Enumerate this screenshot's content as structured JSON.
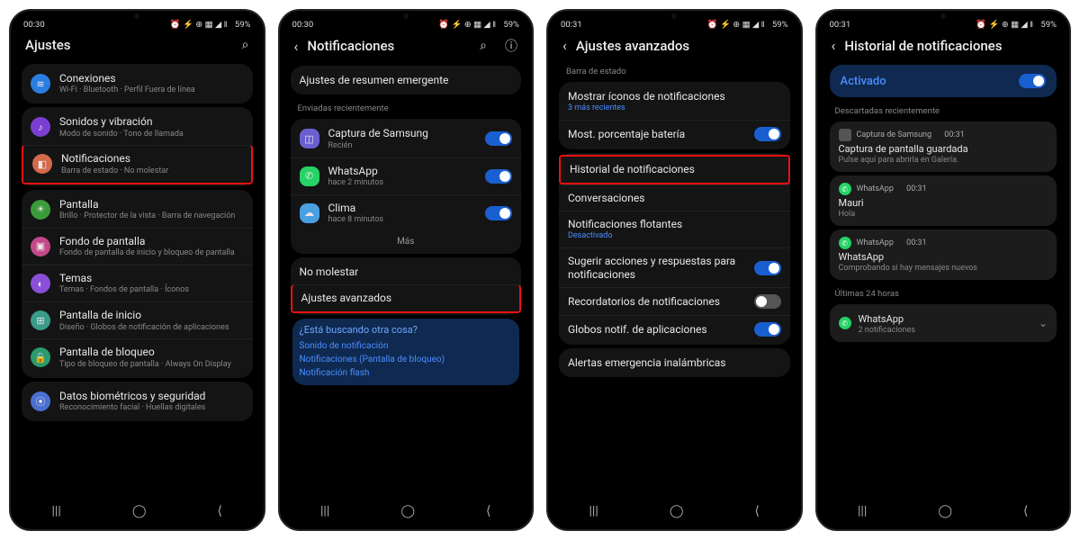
{
  "status": {
    "time1": "00:30",
    "time2": "00:30",
    "time3": "00:31",
    "time4": "00:31",
    "battery": "59%",
    "icons": "⏰ ⚡ ⊕ ▦ ◢ ‖"
  },
  "screen1": {
    "title": "Ajustes",
    "items": [
      {
        "title": "Conexiones",
        "sub": "Wi-Fi · Bluetooth · Perfil Fuera de línea",
        "color": "#2a7de1",
        "glyph": "≋"
      },
      {
        "title": "Sonidos y vibración",
        "sub": "Modo de sonido · Tono de llamada",
        "color": "#7a3fd0",
        "glyph": "♪"
      },
      {
        "title": "Notificaciones",
        "sub": "Barra de estado · No molestar",
        "color": "#d46a4a",
        "glyph": "◧",
        "highlight": true
      },
      {
        "title": "Pantalla",
        "sub": "Brillo · Protector de la vista · Barra de navegación",
        "color": "#3a9b3a",
        "glyph": "☀"
      },
      {
        "title": "Fondo de pantalla",
        "sub": "Fondo de pantalla de inicio y bloqueo de pantalla",
        "color": "#c4488a",
        "glyph": "▣"
      },
      {
        "title": "Temas",
        "sub": "Temas · Fondos de pantalla · Íconos",
        "color": "#8a4fd8",
        "glyph": "◐"
      },
      {
        "title": "Pantalla de inicio",
        "sub": "Diseño · Globos de notificación de aplicaciones",
        "color": "#3a9b8a",
        "glyph": "⊞"
      },
      {
        "title": "Pantalla de bloqueo",
        "sub": "Tipo de bloqueo de pantalla · Always On Display",
        "color": "#2a9b6a",
        "glyph": "🔒"
      },
      {
        "title": "Datos biométricos y seguridad",
        "sub": "Reconocimiento facial · Huellas digitales",
        "color": "#4a6fd0",
        "glyph": "⦿"
      }
    ]
  },
  "screen2": {
    "title": "Notificaciones",
    "popup_row": "Ajustes de resumen emergente",
    "recent_label": "Enviadas recientemente",
    "recent": [
      {
        "app": "Captura de Samsung",
        "sub": "Recién",
        "color": "#6a5fd0",
        "glyph": "◫",
        "on": true
      },
      {
        "app": "WhatsApp",
        "sub": "hace 2 minutos",
        "color": "#25d366",
        "glyph": "✆",
        "on": true
      },
      {
        "app": "Clima",
        "sub": "hace 8 minutos",
        "color": "#4a9fe1",
        "glyph": "☁",
        "on": true
      }
    ],
    "more": "Más",
    "dnd": "No molestar",
    "advanced": "Ajustes avanzados",
    "search_q": "¿Está buscando otra cosa?",
    "search_links": [
      "Sonido de notificación",
      "Notificaciones (Pantalla de bloqueo)",
      "Notificación flash"
    ]
  },
  "screen3": {
    "title": "Ajustes avanzados",
    "status_bar_label": "Barra de estado",
    "items1": [
      {
        "title": "Mostrar íconos de notificaciones",
        "sub": "3 más recientes",
        "sub_blue": true
      },
      {
        "title": "Most. porcentaje batería",
        "toggle": "on"
      }
    ],
    "items2": [
      {
        "title": "Historial de notificaciones",
        "highlight": true
      },
      {
        "title": "Conversaciones"
      },
      {
        "title": "Notificaciones flotantes",
        "sub": "Desactivado",
        "sub_blue": true
      },
      {
        "title": "Sugerir acciones y respuestas para notificaciones",
        "toggle": "on"
      },
      {
        "title": "Recordatorios de notificaciones",
        "toggle": "off"
      },
      {
        "title": "Globos notif. de aplicaciones",
        "toggle": "on"
      }
    ],
    "items3": [
      {
        "title": "Alertas emergencia inalámbricas"
      }
    ]
  },
  "screen4": {
    "title": "Historial de notificaciones",
    "activated": "Activado",
    "dismissed_label": "Descartadas recientemente",
    "dismissed": [
      {
        "app": "Captura de Samsung",
        "time": "00:31",
        "title": "Captura de pantalla guardada",
        "sub": "Pulse aquí para abrirla en Galería.",
        "type": "cap"
      },
      {
        "app": "WhatsApp",
        "time": "00:31",
        "title": "Mauri",
        "sub": "Hola",
        "type": "wa"
      },
      {
        "app": "WhatsApp",
        "time": "00:31",
        "title": "WhatsApp",
        "sub": "Comprobando si hay mensajes nuevos",
        "type": "wa"
      }
    ],
    "last24_label": "Últimas 24 horas",
    "last24": {
      "app": "WhatsApp",
      "count": "2 notificaciones"
    }
  }
}
